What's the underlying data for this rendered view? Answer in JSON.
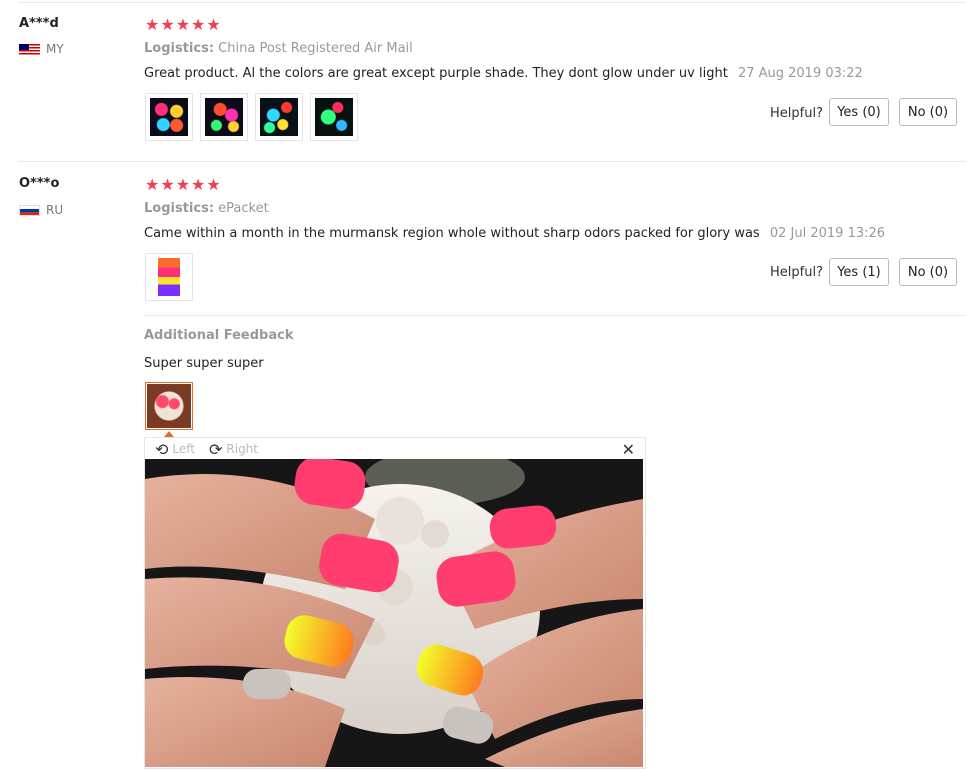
{
  "reviews": [
    {
      "user": "A***d",
      "country": "MY",
      "stars": "★★★★★",
      "logistics_label": "Logistics:",
      "logistics_value": "China Post Registered Air Mail",
      "text": "Great product. Al the colors are great except purple shade. They dont glow under uv light",
      "date": "27 Aug 2019 03:22",
      "helpful_label": "Helpful?",
      "yes_label": "Yes (0)",
      "no_label": "No (0)"
    },
    {
      "user": "O***o",
      "country": "RU",
      "stars": "★★★★★",
      "logistics_label": "Logistics:",
      "logistics_value": "ePacket",
      "text": "Came within a month in the murmansk region whole without sharp odors packed for glory was",
      "date": "02 Jul 2019 13:26",
      "helpful_label": "Helpful?",
      "yes_label": "Yes (1)",
      "no_label": "No (0)",
      "additional_title": "Additional Feedback",
      "additional_text": "Super super super"
    }
  ],
  "viewer": {
    "left_label": "Left",
    "right_label": "Right",
    "rotate_left_icon": "rotate-left-icon",
    "rotate_right_icon": "rotate-right-icon",
    "close_icon": "close-icon"
  },
  "colors": {
    "stars": "#f0414b",
    "muted": "#999999",
    "border": "#e8e8e8"
  }
}
